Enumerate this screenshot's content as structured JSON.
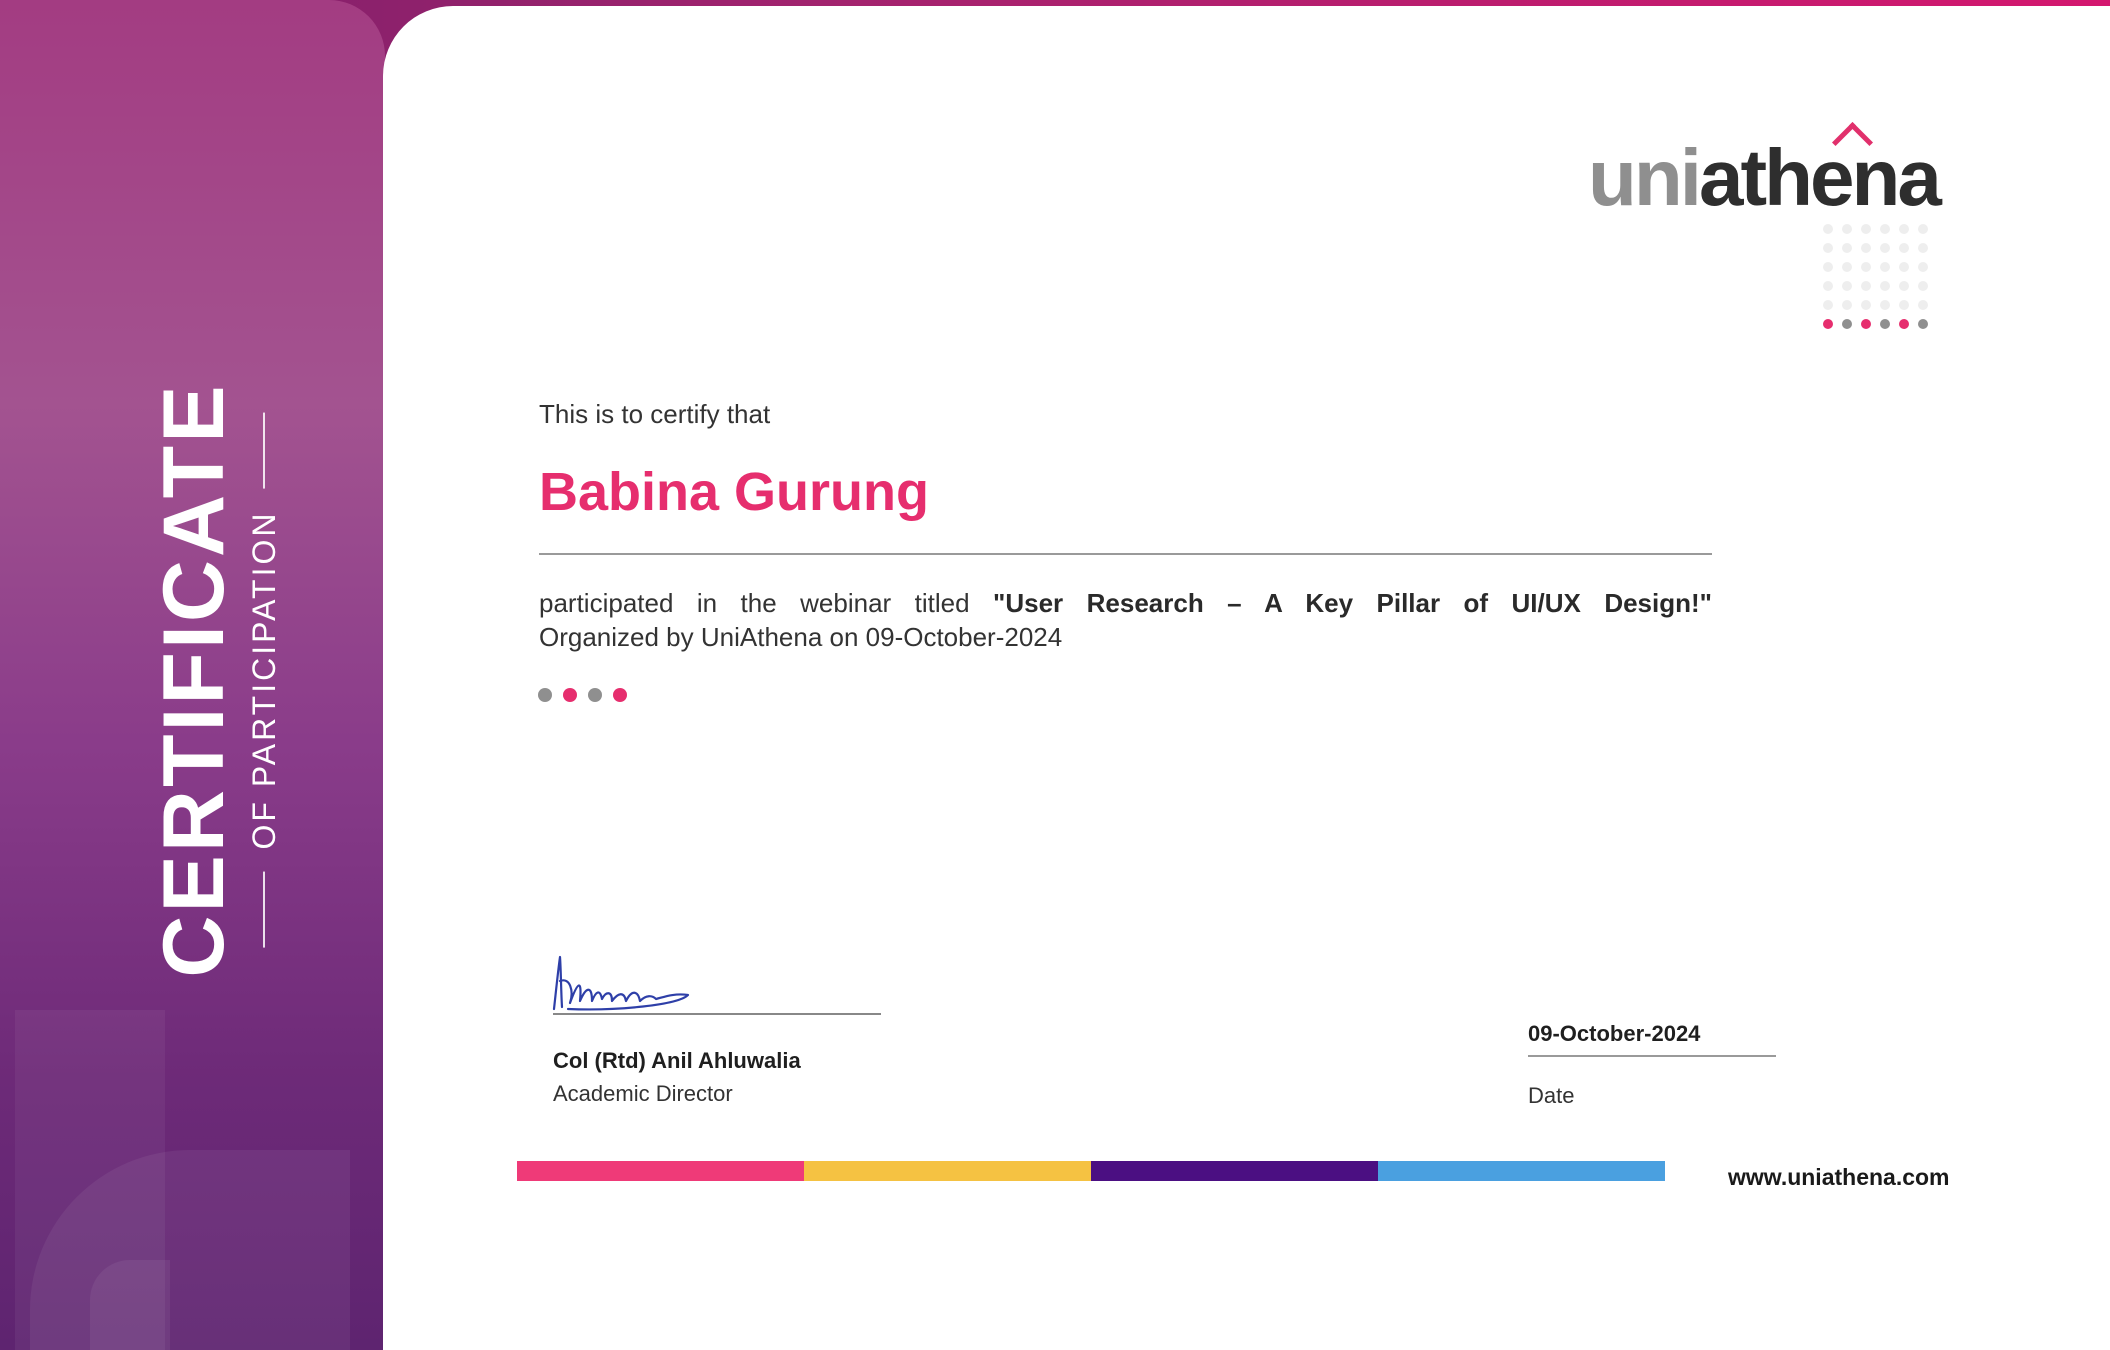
{
  "sidebar": {
    "title": "CERTIFICATE",
    "subtitle": "OF PARTICIPATION"
  },
  "logo": {
    "part1": "uni",
    "part2": "athena"
  },
  "certificate": {
    "intro": "This is to certify that",
    "recipient": "Babina Gurung",
    "body_lead": "participated in the webinar titled",
    "webinar_title": "\"User Research – A Key Pillar of UI/UX Design!\"",
    "body_tail": "Organized by UniAthena on 09-October-2024"
  },
  "signatory": {
    "signature_text": "Ahluwalia",
    "name": "Col (Rtd) Anil Ahluwalia",
    "title": "Academic Director"
  },
  "issue": {
    "date": "09-October-2024",
    "label": "Date"
  },
  "footer": {
    "website": "www.uniathena.com"
  },
  "colors": {
    "accent_pink": "#e62e6e",
    "yellow": "#f5c242",
    "purple": "#4b0f82",
    "blue": "#4aa0e0",
    "gray": "#8f8f8f",
    "pale_dot": "#eeeeee"
  },
  "decor": {
    "small_dot_colors": [
      "#8f8f8f",
      "#e62e6e",
      "#8f8f8f",
      "#e62e6e"
    ],
    "grid_bottom_row_colors": [
      "#e62e6e",
      "#8f8f8f",
      "#e62e6e",
      "#8f8f8f",
      "#e62e6e",
      "#8f8f8f"
    ],
    "bar_colors": [
      "#ef3a78",
      "#f5c242",
      "#4b0f82",
      "#4aa0e0"
    ]
  }
}
